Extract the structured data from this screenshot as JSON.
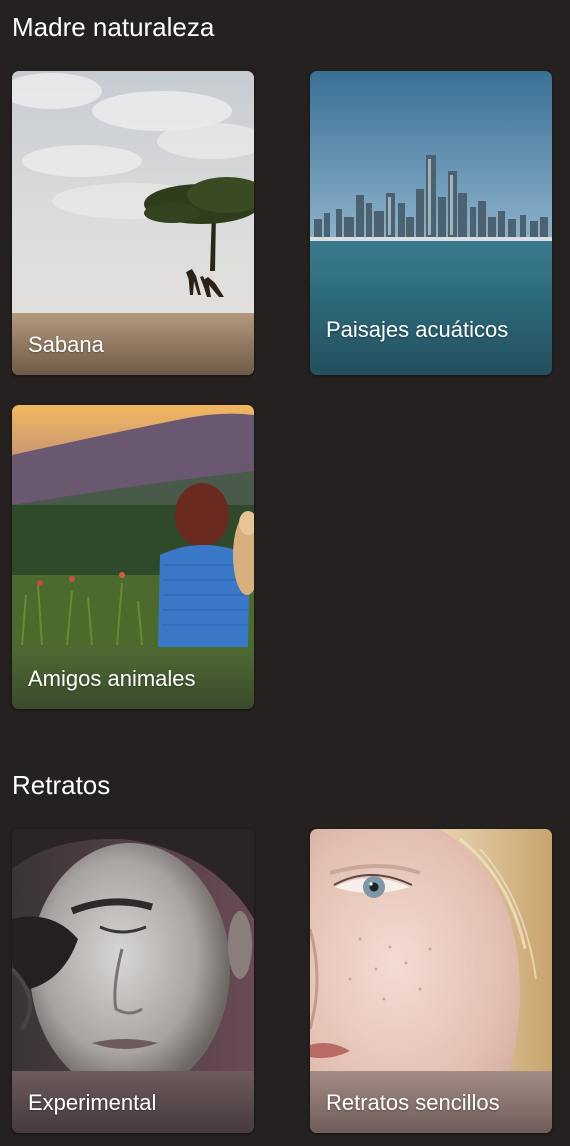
{
  "sections": [
    {
      "title": "Madre naturaleza",
      "cards": [
        {
          "label": "Sabana",
          "image": "savanna-giraffes-photo",
          "caption_color": "#8a7560"
        },
        {
          "label": "Paisajes acuáticos",
          "image": "city-skyline-water-photo",
          "caption_color": "#2f6f80"
        },
        {
          "label": "Amigos animales",
          "image": "woman-with-dog-field-photo",
          "caption_color": "#4e5a36"
        }
      ]
    },
    {
      "title": "Retratos",
      "cards": [
        {
          "label": "Experimental",
          "image": "bw-portrait-with-rose-photo",
          "caption_color": "#5c4a4c"
        },
        {
          "label": "Retratos sencillos",
          "image": "freckled-face-closeup-photo",
          "caption_color": "#857473"
        }
      ]
    }
  ]
}
